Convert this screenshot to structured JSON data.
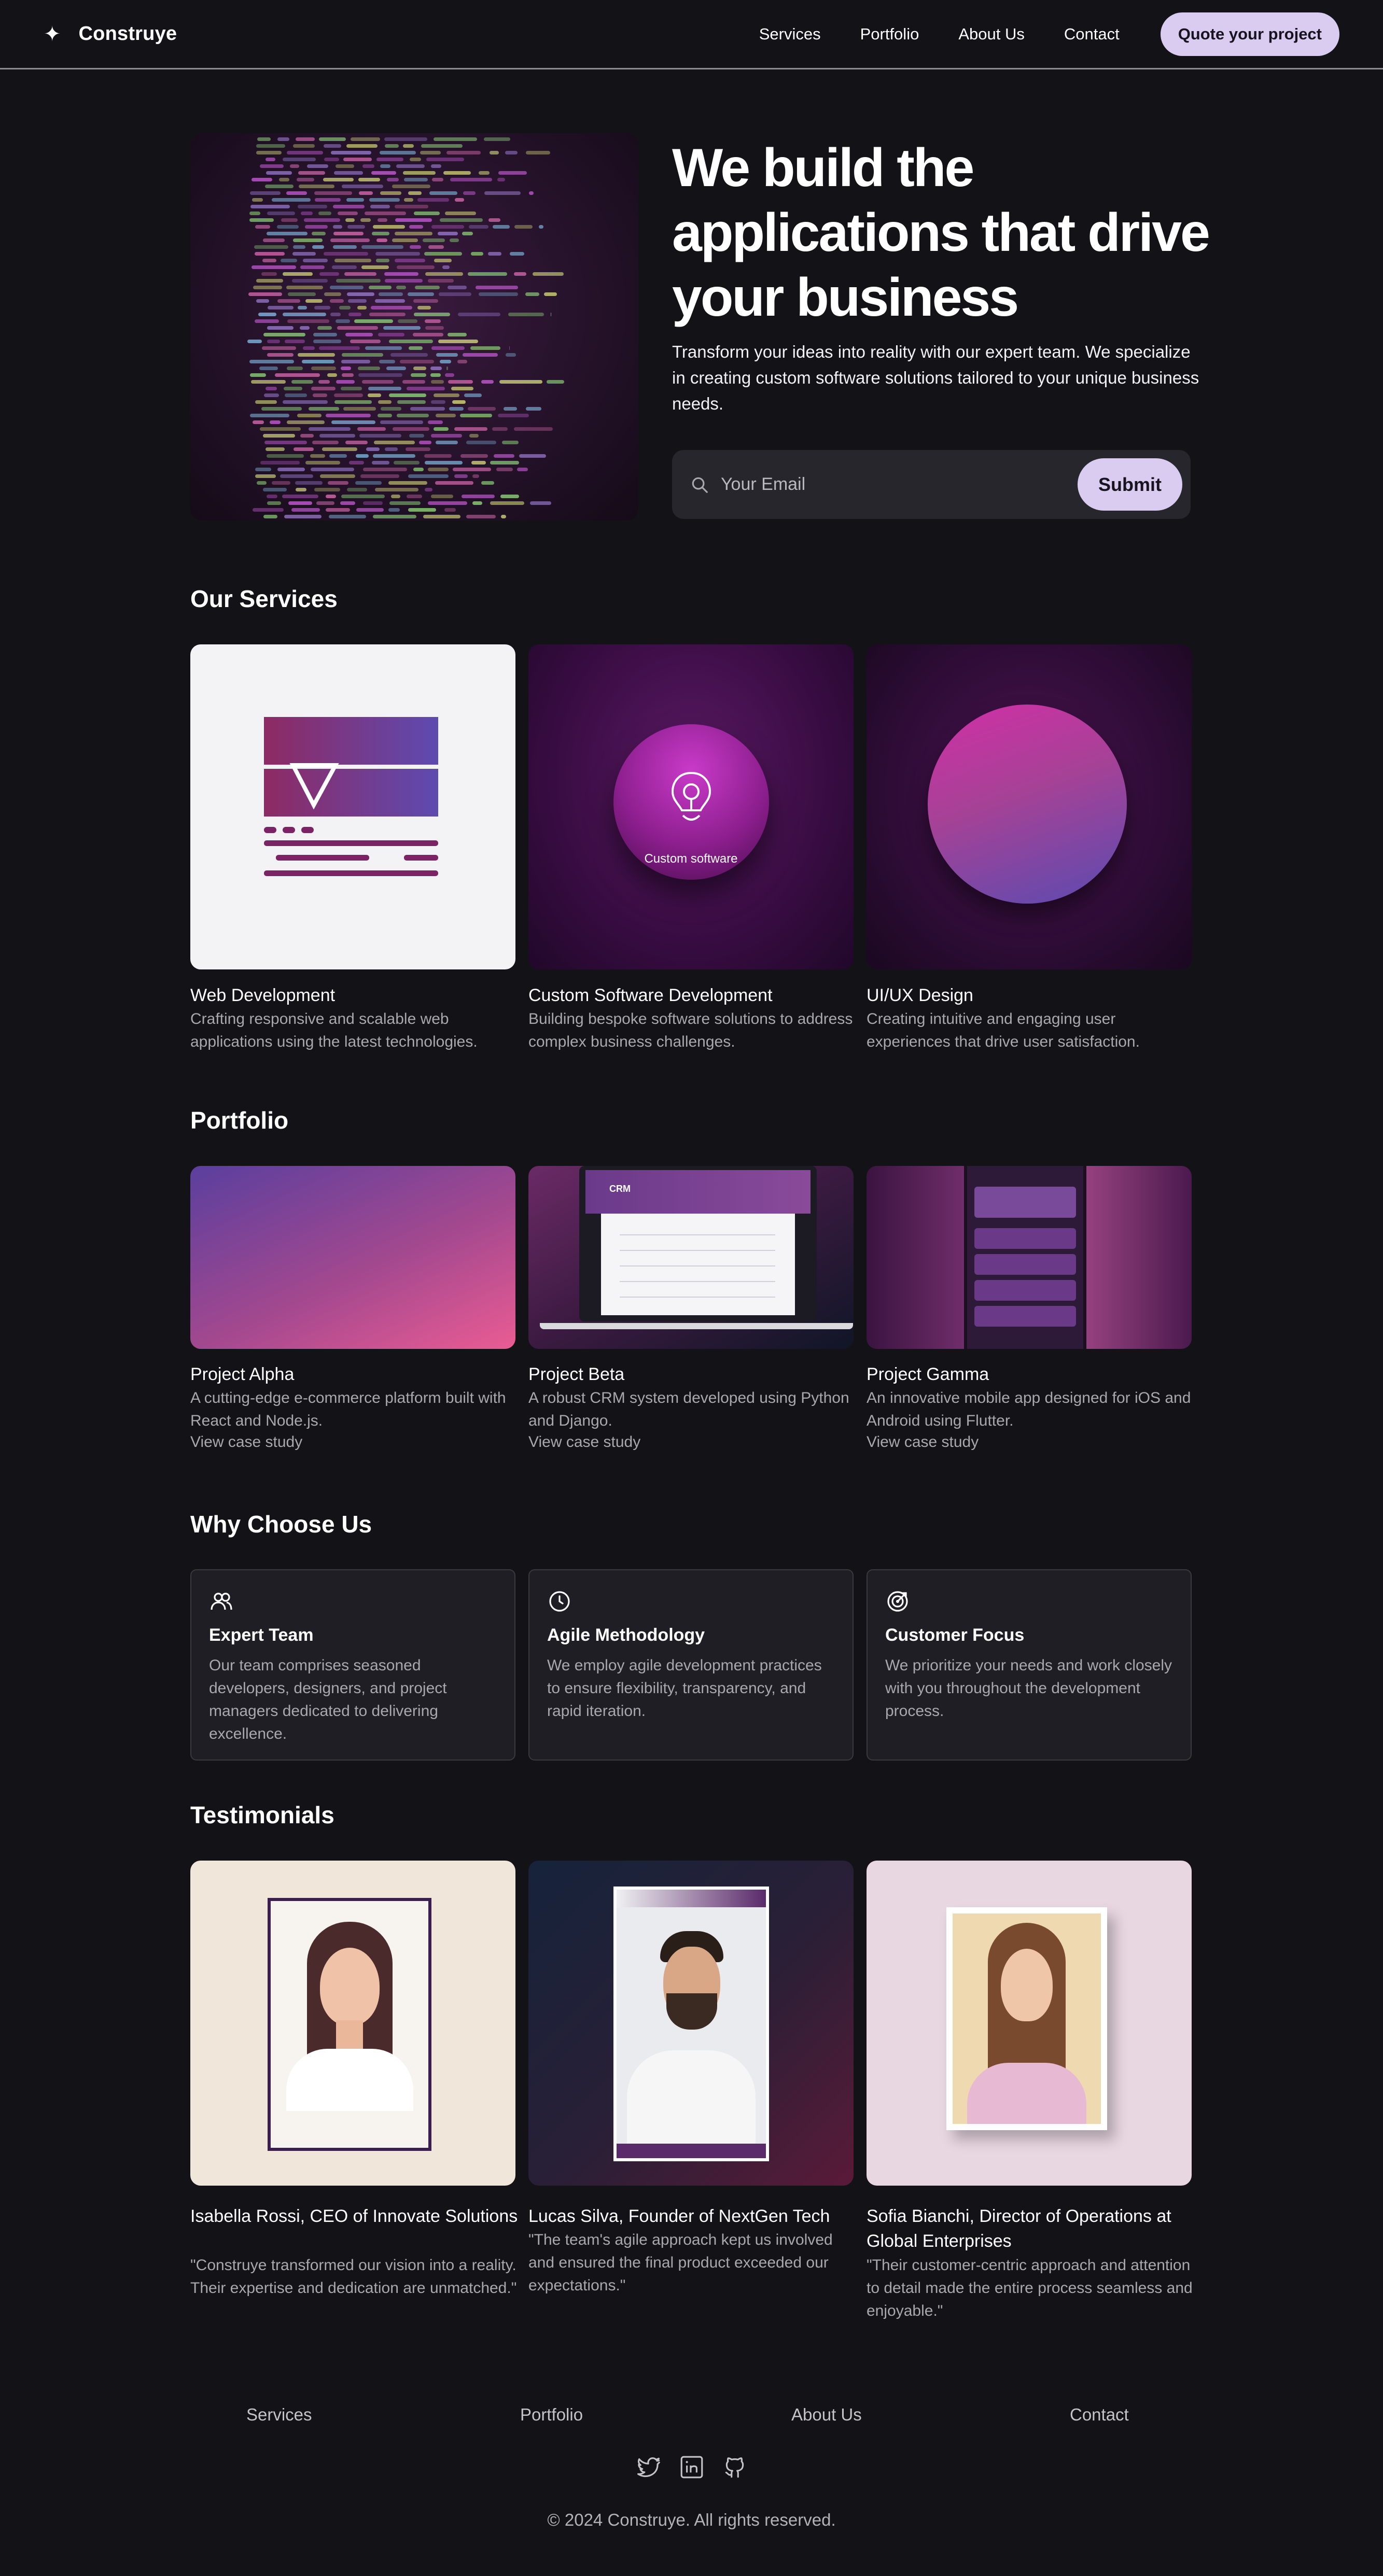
{
  "nav": {
    "brand_icon": "sparkle-icon",
    "brand": "Construye",
    "links": [
      "Services",
      "Portfolio",
      "About Us",
      "Contact"
    ],
    "quote_button": "Quote your project"
  },
  "hero": {
    "title": "We build the applications that drive your business",
    "subtitle": "Transform your ideas into reality with our expert team. We specialize in creating custom software solutions tailored to your unique business needs.",
    "email_placeholder": "Your Email",
    "submit": "Submit"
  },
  "services": {
    "heading": "Our Services",
    "items": [
      {
        "title": "Web Development",
        "desc": "Crafting responsive and scalable web applications using the latest technologies."
      },
      {
        "title": "Custom Software Development",
        "desc": "Building bespoke software solutions to address complex business challenges.",
        "image_caption": "Custom software"
      },
      {
        "title": "UI/UX Design",
        "desc": "Creating intuitive and engaging user experiences that drive user satisfaction."
      }
    ]
  },
  "portfolio": {
    "heading": "Portfolio",
    "items": [
      {
        "title": "Project Alpha",
        "desc": "A cutting-edge e-commerce platform built with React and Node.js.",
        "link": "View case study"
      },
      {
        "title": "Project Beta",
        "desc": "A robust CRM system developed using Python and Django.",
        "link": "View case study",
        "image_label": "CRM"
      },
      {
        "title": "Project Gamma",
        "desc": "An innovative mobile app designed for iOS and Android using Flutter.",
        "link": "View case study"
      }
    ]
  },
  "why": {
    "heading": "Why Choose Us",
    "items": [
      {
        "icon": "users-icon",
        "title": "Expert Team",
        "desc": "Our team comprises seasoned developers, designers, and project managers dedicated to delivering excellence."
      },
      {
        "icon": "clock-icon",
        "title": "Agile Methodology",
        "desc": "We employ agile development practices to ensure flexibility, transparency, and rapid iteration."
      },
      {
        "icon": "target-icon",
        "title": "Customer Focus",
        "desc": "We prioritize your needs and work closely with you throughout the development process."
      }
    ]
  },
  "testimonials": {
    "heading": "Testimonials",
    "items": [
      {
        "name": "Isabella Rossi, CEO of Innovate Solutions",
        "quote": "\"Construye transformed our vision into a reality. Their expertise and dedication are unmatched.\""
      },
      {
        "name": "Lucas Silva, Founder of NextGen Tech",
        "quote": "\"The team's agile approach kept us involved and ensured the final product exceeded our expectations.\""
      },
      {
        "name": "Sofia Bianchi, Director of Operations at Global Enterprises",
        "quote": "\"Their customer-centric approach and attention to detail made the entire process seamless and enjoyable.\""
      }
    ]
  },
  "footer": {
    "links": [
      "Services",
      "Portfolio",
      "About Us",
      "Contact"
    ],
    "social": [
      "twitter-icon",
      "linkedin-icon",
      "github-icon"
    ],
    "copyright": "© 2024 Construye. All rights reserved."
  },
  "colors": {
    "background": "#131217",
    "accent": "#d9ccf0",
    "card": "#1f1e24",
    "muted_text": "#a9a8ae"
  }
}
